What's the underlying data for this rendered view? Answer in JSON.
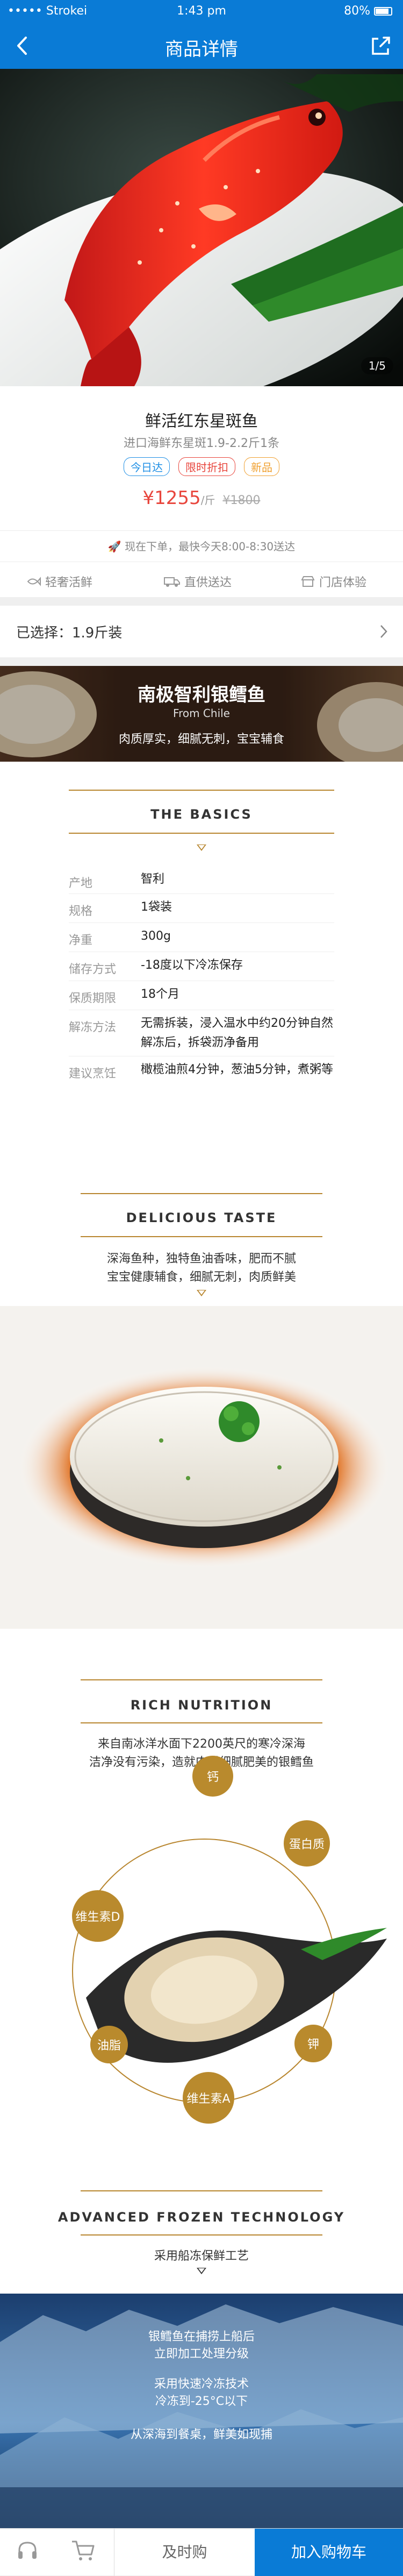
{
  "status": {
    "carrier": "••••• Strokei",
    "time": "1:43 pm",
    "battery": "80%"
  },
  "nav": {
    "title": "商品详情"
  },
  "hero": {
    "counter": "1/5"
  },
  "product": {
    "name": "鲜活红东星斑鱼",
    "subtitle": "进口海鲜东星斑1.9-2.2斤1条",
    "tags": [
      "今日达",
      "限时折扣",
      "新品"
    ],
    "price": "¥1255",
    "unit": "/斤",
    "old_price": "¥1800"
  },
  "delivery": {
    "text": "现在下单，最快今天8:00-8:30送达"
  },
  "features": [
    "轻奢活鲜",
    "直供送达",
    "门店体验"
  ],
  "selection": {
    "label": "已选择：1.9斤装"
  },
  "banner": {
    "title": "南极智利银鳕鱼",
    "subtitle": "From Chile",
    "desc": "肉质厚实，细腻无刺，宝宝辅食"
  },
  "basics": {
    "title": "THE BASICS",
    "rows": [
      {
        "k": "产地",
        "v": "智利"
      },
      {
        "k": "规格",
        "v": "1袋装"
      },
      {
        "k": "净重",
        "v": "300g"
      },
      {
        "k": "储存方式",
        "v": "-18度以下冷冻保存"
      },
      {
        "k": "保质期限",
        "v": "18个月"
      },
      {
        "k": "解冻方法",
        "v": "无需拆装，浸入温水中约20分钟自然解冻后，拆袋沥净备用"
      },
      {
        "k": "建议烹饪",
        "v": "橄榄油煎4分钟，葱油5分钟，煮粥等"
      }
    ]
  },
  "taste": {
    "title": "DELICIOUS TASTE",
    "line1": "深海鱼种，独特鱼油香味，肥而不腻",
    "line2": "宝宝健康辅食，细腻无刺，肉质鲜美"
  },
  "nutrition": {
    "title": "RICH NUTRITION",
    "line1": "来自南冰洋水面下2200英尺的寒冷深海",
    "line2": "洁净没有污染，造就肉质细腻肥美的银鳕鱼",
    "nutrients": [
      "钙",
      "蛋白质",
      "钾",
      "维生素A",
      "油脂",
      "维生素D"
    ]
  },
  "frozen": {
    "title": "ADVANCED FROZEN TECHNOLOGY",
    "subtitle": "采用船冻保鲜工艺",
    "p1a": "银鳕鱼在捕捞上船后",
    "p1b": "立即加工处理分级",
    "p2a": "采用快速冷冻技术",
    "p2b": "冷冻到-25°C以下",
    "p3": "从深海到餐桌，鲜美如现捕"
  },
  "bottom": {
    "buy_later": "及时购",
    "add_cart": "加入购物车"
  },
  "colors": {
    "brand_blue": "#0a7bd6",
    "price_red": "#e8453c",
    "gold": "#b8862f"
  }
}
